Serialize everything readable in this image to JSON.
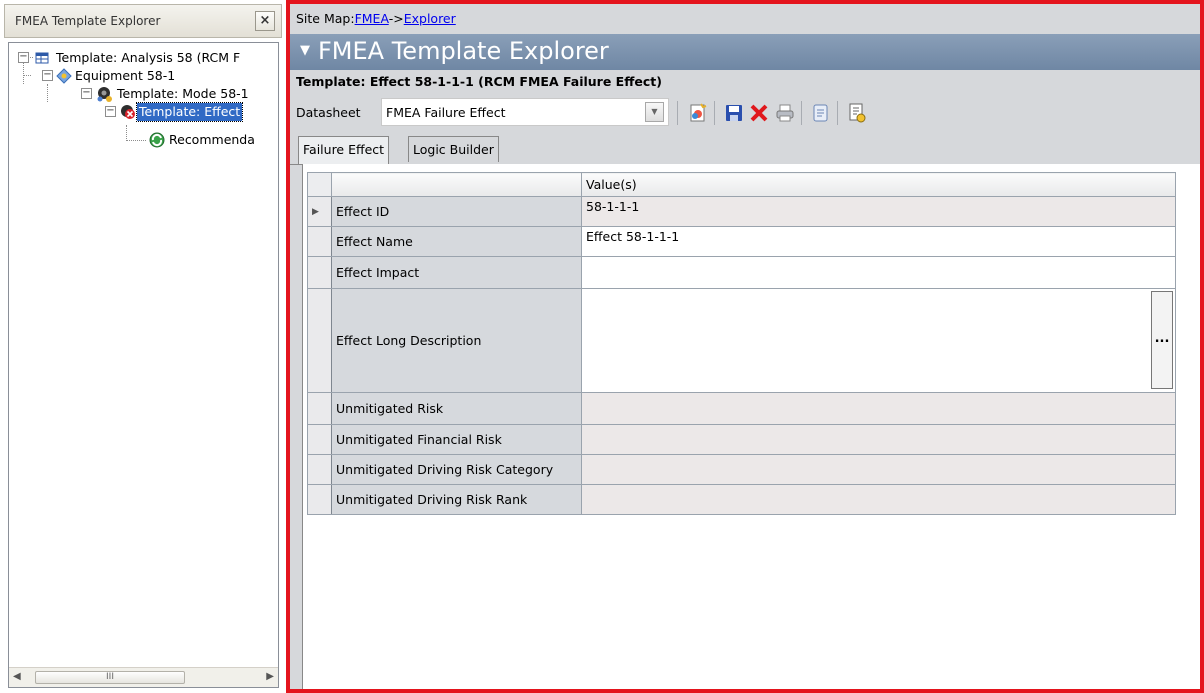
{
  "explorer": {
    "title": "FMEA Template Explorer",
    "close_label": "×",
    "tree": [
      {
        "label": "Template: Analysis 58 (RCM F",
        "expander": "−"
      },
      {
        "label": "Equipment 58-1",
        "expander": "−"
      },
      {
        "label": "Template: Mode 58-1",
        "expander": "−"
      },
      {
        "label": "Template: Effect",
        "expander": "−"
      },
      {
        "label": "Recommenda"
      }
    ],
    "scrollbar": {
      "left_arrow": "◀",
      "right_arrow": "▶",
      "thumb": "III"
    }
  },
  "sitemap": {
    "prefix": "Site Map:",
    "links": [
      "FMEA",
      "Explorer"
    ],
    "separator": "->"
  },
  "banner": {
    "caret": "▼",
    "title": "FMEA Template Explorer"
  },
  "record_title": "Template: Effect 58-1-1-1 (RCM FMEA Failure Effect)",
  "datasheet": {
    "label": "Datasheet",
    "value": "FMEA Failure Effect",
    "dropdown_icon": "▼"
  },
  "toolbar": [
    "new-record-icon",
    "save-icon",
    "delete-icon",
    "print-icon",
    "search-icon",
    "report-icon"
  ],
  "tabs": [
    "Failure Effect",
    "Logic Builder"
  ],
  "grid": {
    "column_header": "Value(s)",
    "row_marker": "▶",
    "ellipsis": "...",
    "rows": [
      {
        "label": "Effect ID",
        "value": "58-1-1-1"
      },
      {
        "label": "Effect Name",
        "value": "Effect 58-1-1-1"
      },
      {
        "label": "Effect Impact",
        "value": ""
      },
      {
        "label": "Effect Long Description",
        "value": ""
      },
      {
        "label": "Unmitigated Risk",
        "value": ""
      },
      {
        "label": "Unmitigated Financial Risk",
        "value": ""
      },
      {
        "label": "Unmitigated Driving Risk Category",
        "value": ""
      },
      {
        "label": "Unmitigated Driving Risk Rank",
        "value": ""
      }
    ]
  },
  "colors": {
    "frame": "#e4141d",
    "banner": "#6f87a4",
    "selection": "#316ac5"
  }
}
